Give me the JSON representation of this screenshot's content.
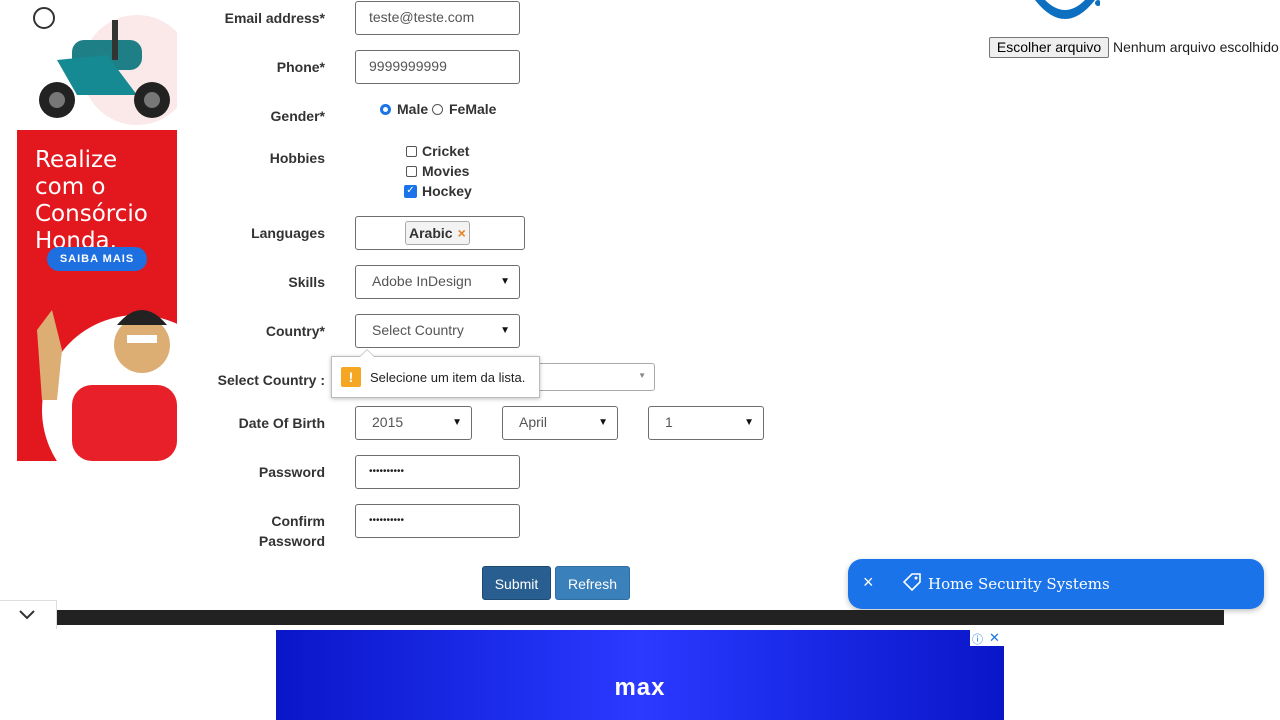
{
  "left_ad": {
    "headline": "Realize com o Consórcio Honda.",
    "cta": "SAIBA MAIS",
    "brand_color": "#e3181f"
  },
  "form": {
    "email": {
      "label": "Email address*",
      "value": "teste@teste.com"
    },
    "phone": {
      "label": "Phone*",
      "value": "9999999999"
    },
    "gender": {
      "label": "Gender*",
      "options": [
        "Male",
        "FeMale"
      ],
      "selected": "Male"
    },
    "hobbies": {
      "label": "Hobbies",
      "options": [
        {
          "label": "Cricket",
          "checked": false
        },
        {
          "label": "Movies",
          "checked": false
        },
        {
          "label": "Hockey",
          "checked": true
        }
      ]
    },
    "languages": {
      "label": "Languages",
      "selected": [
        "Arabic"
      ],
      "remove_icon": "×"
    },
    "skills": {
      "label": "Skills",
      "value": "Adobe InDesign"
    },
    "country": {
      "label": "Country*",
      "value": "Select Country"
    },
    "select_country": {
      "label": "Select Country :"
    },
    "validation_tooltip": {
      "text": "Selecione um item da lista.",
      "icon": "!"
    },
    "dob": {
      "label": "Date Of Birth",
      "year": "2015",
      "month": "April",
      "day": "1"
    },
    "password": {
      "label": "Password",
      "value": "••••••••••"
    },
    "confirm_password": {
      "label_line1": "Confirm",
      "label_line2": "Password",
      "value": "••••••••••"
    },
    "submit_label": "Submit",
    "refresh_label": "Refresh"
  },
  "file_upload": {
    "button_label": "Escolher arquivo",
    "status_text": "Nenhum arquivo escolhido"
  },
  "toast": {
    "text": "Home Security Systems",
    "close_icon": "×",
    "color": "#1a73e8"
  },
  "bottom_ad": {
    "logo_text": "max"
  },
  "collapse_icon": "chevron-down-icon"
}
